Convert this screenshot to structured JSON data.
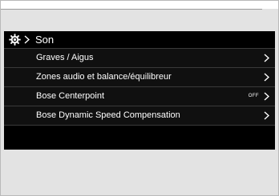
{
  "screen": {
    "title": "Son",
    "header_icon": "gear-icon",
    "header_separator_icon": "chevron-right-icon"
  },
  "menu": {
    "items": [
      {
        "label": "Graves / Aigus",
        "value": "",
        "icon": "chevron-right-icon"
      },
      {
        "label": "Zones audio et balance/équilibreur",
        "value": "",
        "icon": "chevron-right-icon"
      },
      {
        "label": "Bose Centerpoint",
        "value": "OFF",
        "icon": "chevron-right-icon"
      },
      {
        "label": "Bose Dynamic Speed Compensation",
        "value": "",
        "icon": "chevron-right-icon"
      }
    ]
  },
  "colors": {
    "screen_bg": "#000000",
    "row_bg": "#101010",
    "divider": "#3a3a3a",
    "text": "#ffffff",
    "page_bg": "#e3e3e3"
  }
}
